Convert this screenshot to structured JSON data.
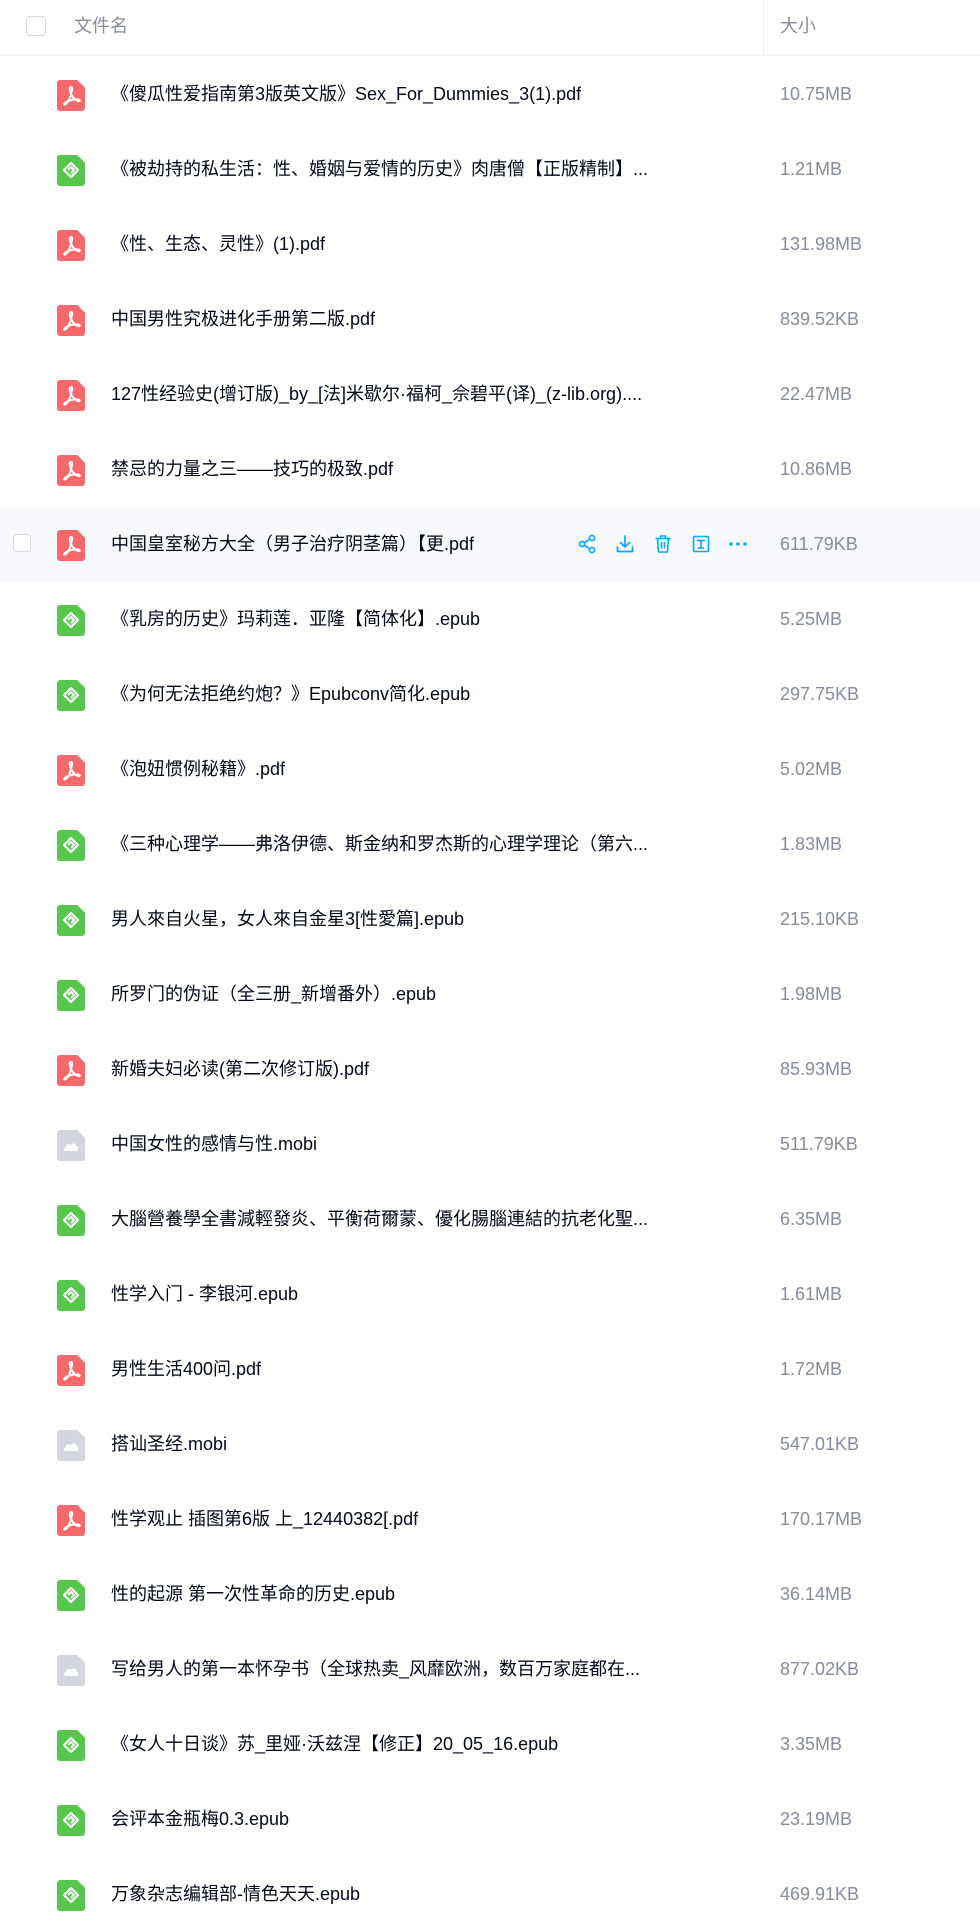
{
  "header": {
    "name_label": "文件名",
    "size_label": "大小"
  },
  "colors": {
    "pdf": "#f5686b",
    "epub": "#57c64d",
    "mobi": "#d3d6dc",
    "action": "#06a7ff"
  },
  "actions": [
    {
      "icon": "share-icon"
    },
    {
      "icon": "download-icon"
    },
    {
      "icon": "delete-icon"
    },
    {
      "icon": "rename-icon"
    },
    {
      "icon": "more-icon"
    }
  ],
  "files": [
    {
      "type": "pdf",
      "name": "《傻瓜性爱指南第3版英文版》Sex_For_Dummies_3(1).pdf",
      "size": "10.75MB"
    },
    {
      "type": "epub",
      "name": "《被劫持的私生活：性、婚姻与爱情的历史》肉唐僧【正版精制】...",
      "size": "1.21MB"
    },
    {
      "type": "pdf",
      "name": "《性、生态、灵性》(1).pdf",
      "size": "131.98MB"
    },
    {
      "type": "pdf",
      "name": "中国男性究极进化手册第二版.pdf",
      "size": "839.52KB"
    },
    {
      "type": "pdf",
      "name": "127性经验史(增订版)_by_[法]米歇尔·福柯_佘碧平(译)_(z-lib.org)....",
      "size": "22.47MB"
    },
    {
      "type": "pdf",
      "name": "禁忌的力量之三——技巧的极致.pdf",
      "size": "10.86MB"
    },
    {
      "type": "pdf",
      "name": "中国皇室秘方大全（男子治疗阴茎篇）【更.pdf",
      "size": "611.79KB",
      "hover": true
    },
    {
      "type": "epub",
      "name": "《乳房的历史》玛莉莲．亚隆【简体化】.epub",
      "size": "5.25MB"
    },
    {
      "type": "epub",
      "name": "《为何无法拒绝约炮？》Epubconv简化.epub",
      "size": "297.75KB"
    },
    {
      "type": "pdf",
      "name": "《泡妞惯例秘籍》.pdf",
      "size": "5.02MB"
    },
    {
      "type": "epub",
      "name": "《三种心理学——弗洛伊德、斯金纳和罗杰斯的心理学理论（第六...",
      "size": "1.83MB"
    },
    {
      "type": "epub",
      "name": "男人來自火星，女人來自金星3[性愛篇].epub",
      "size": "215.10KB"
    },
    {
      "type": "epub",
      "name": "所罗门的伪证（全三册_新增番外）.epub",
      "size": "1.98MB"
    },
    {
      "type": "pdf",
      "name": "新婚夫妇必读(第二次修订版).pdf",
      "size": "85.93MB"
    },
    {
      "type": "mobi",
      "name": "中国女性的感情与性.mobi",
      "size": "511.79KB"
    },
    {
      "type": "epub",
      "name": "大腦營養學全書減輕發炎、平衡荷爾蒙、優化腸腦連結的抗老化聖...",
      "size": "6.35MB"
    },
    {
      "type": "epub",
      "name": "性学入门 - 李银河.epub",
      "size": "1.61MB"
    },
    {
      "type": "pdf",
      "name": "男性生活400问.pdf",
      "size": "1.72MB"
    },
    {
      "type": "mobi",
      "name": "搭讪圣经.mobi",
      "size": "547.01KB"
    },
    {
      "type": "pdf",
      "name": "性学观止 插图第6版 上_12440382[.pdf",
      "size": "170.17MB"
    },
    {
      "type": "epub",
      "name": "性的起源 第一次性革命的历史.epub",
      "size": "36.14MB"
    },
    {
      "type": "mobi",
      "name": "写给男人的第一本怀孕书（全球热卖_风靡欧洲，数百万家庭都在...",
      "size": "877.02KB"
    },
    {
      "type": "epub",
      "name": "《女人十日谈》苏_里娅·沃兹涅【修正】20_05_16.epub",
      "size": "3.35MB"
    },
    {
      "type": "epub",
      "name": "会评本金瓶梅0.3.epub",
      "size": "23.19MB"
    },
    {
      "type": "epub",
      "name": "万象杂志编辑部-情色天天.epub",
      "size": "469.91KB"
    }
  ]
}
